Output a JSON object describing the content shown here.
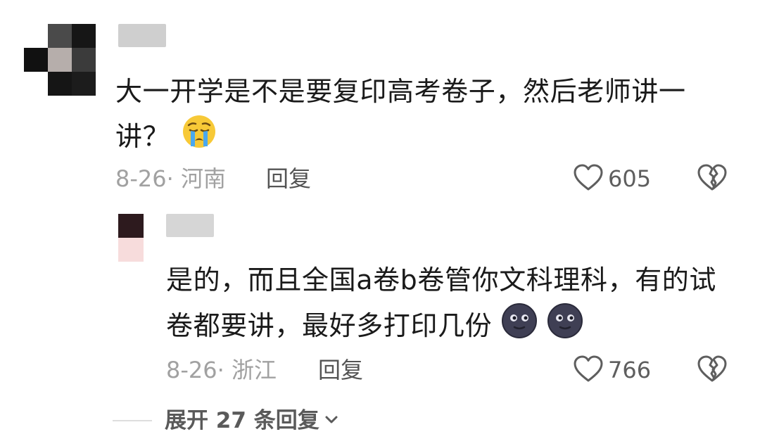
{
  "comments": [
    {
      "text_line1": "大一开学是不是要复印高考卷子，然后老师讲一",
      "text_line2": "讲？",
      "date": "8-26",
      "location": "· 河南",
      "reply_label": "回复",
      "likes": "605",
      "emoji": "loudly-crying-face"
    }
  ],
  "replies": [
    {
      "text_line1": "是的，而且全国a卷b卷管你文科理科，有的试",
      "text_line2": "卷都要讲，最好多打印几份",
      "date": "8-26",
      "location": "· 浙江",
      "reply_label": "回复",
      "likes": "766",
      "emoji": "new-moon-face"
    }
  ],
  "expand": {
    "label": "展开 27 条回复"
  },
  "colors": {
    "text": "#1a1a1a",
    "meta": "#a1a1a1",
    "action": "#545454"
  }
}
